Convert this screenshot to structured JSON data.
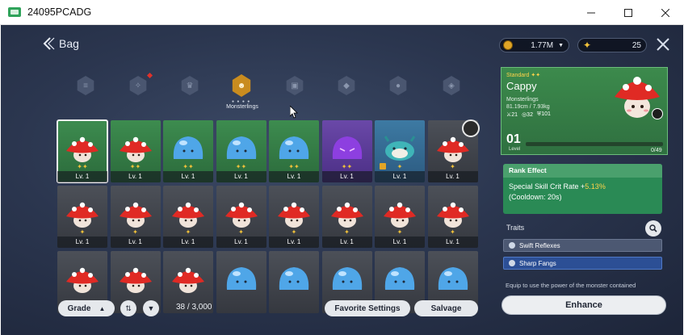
{
  "window": {
    "title": "24095PCADG",
    "controls": {
      "minimize": "—",
      "maximize": "☐",
      "close": "✕"
    }
  },
  "header": {
    "back_icon": "back-arrow-icon",
    "title": "Bag",
    "gold": "1.77M",
    "star": "25"
  },
  "categories": [
    {
      "icon": "all-icon",
      "glyph": "≡"
    },
    {
      "icon": "gift-icon",
      "glyph": "✧",
      "has_notification": true
    },
    {
      "icon": "crown-icon",
      "glyph": "♛"
    },
    {
      "icon": "monster-icon",
      "glyph": "☻",
      "label": "Monsterlings",
      "active": true
    },
    {
      "icon": "box-icon",
      "glyph": "▣"
    },
    {
      "icon": "diamond-icon",
      "glyph": "◆"
    },
    {
      "icon": "bomb-icon",
      "glyph": "●"
    },
    {
      "icon": "gem-icon",
      "glyph": "◈"
    }
  ],
  "grid": {
    "rows": [
      [
        {
          "kind": "mushroom",
          "bg": "green",
          "level": "Lv. 1",
          "selected": true,
          "rank": "✦✦"
        },
        {
          "kind": "mushroom",
          "bg": "green",
          "level": "Lv. 1",
          "rank": "✦✦"
        },
        {
          "kind": "slime",
          "bg": "green",
          "level": "Lv. 1",
          "rank": "✦✦"
        },
        {
          "kind": "slime",
          "bg": "green",
          "level": "Lv. 1",
          "rank": "✦✦"
        },
        {
          "kind": "slime",
          "bg": "green",
          "level": "Lv. 1",
          "rank": "✦✦"
        },
        {
          "kind": "evil-slime",
          "bg": "purple",
          "level": "Lv. 1",
          "rank": "✦✦"
        },
        {
          "kind": "axolotl",
          "bg": "teal",
          "level": "Lv. 1",
          "rank": "✦"
        },
        {
          "kind": "mushroom",
          "bg": "gray",
          "level": "Lv. 1",
          "rank": "✦"
        }
      ],
      [
        {
          "kind": "mushroom",
          "bg": "gray",
          "level": "Lv. 1",
          "rank": "✦"
        },
        {
          "kind": "mushroom",
          "bg": "gray",
          "level": "Lv. 1",
          "rank": "✦"
        },
        {
          "kind": "mushroom",
          "bg": "gray",
          "level": "Lv. 1",
          "rank": "✦"
        },
        {
          "kind": "mushroom",
          "bg": "gray",
          "level": "Lv. 1",
          "rank": "✦"
        },
        {
          "kind": "mushroom",
          "bg": "gray",
          "level": "Lv. 1",
          "rank": "✦"
        },
        {
          "kind": "mushroom",
          "bg": "gray",
          "level": "Lv. 1",
          "rank": "✦"
        },
        {
          "kind": "mushroom",
          "bg": "gray",
          "level": "Lv. 1",
          "rank": "✦"
        },
        {
          "kind": "mushroom",
          "bg": "gray",
          "level": "Lv. 1",
          "rank": "✦"
        }
      ],
      [
        {
          "kind": "mushroom",
          "bg": "gray"
        },
        {
          "kind": "mushroom",
          "bg": "gray"
        },
        {
          "kind": "mushroom",
          "bg": "gray"
        },
        {
          "kind": "slime",
          "bg": "gray"
        },
        {
          "kind": "slime",
          "bg": "gray"
        },
        {
          "kind": "slime",
          "bg": "gray"
        },
        {
          "kind": "slime",
          "bg": "gray"
        },
        {
          "kind": "slime",
          "bg": "gray"
        }
      ]
    ]
  },
  "bottom_bar": {
    "grade_label": "Grade",
    "grade_caret": "▲",
    "count": "38 / 3,000",
    "favorite_label": "Favorite Settings",
    "salvage_label": "Salvage"
  },
  "detail": {
    "grade": "Standard",
    "name": "Cappy",
    "family": "Monsterlings",
    "size": "81.19cm / 7.93kg",
    "stats": [
      "⚔21",
      "◎32",
      "⛨101"
    ],
    "level_num": "01",
    "level_label": "Level",
    "xp": "0/49",
    "xp_fraction": 0.0
  },
  "rank_effect": {
    "title": "Rank Effect",
    "line1_prefix": "Special Skill Crit Rate +",
    "line1_value": "5.13%",
    "line2": "(Cooldown: 20s)"
  },
  "traits": {
    "title": "Traits",
    "items": [
      "Swift Reflexes",
      "Sharp Fangs"
    ]
  },
  "equip_hint": "Equip to use the power of the monster contained",
  "enhance_label": "Enhance",
  "colors": {
    "green_slot": "#3d8c4f",
    "gold_accent": "#c98c1f",
    "highlight": "#ffd34a"
  }
}
